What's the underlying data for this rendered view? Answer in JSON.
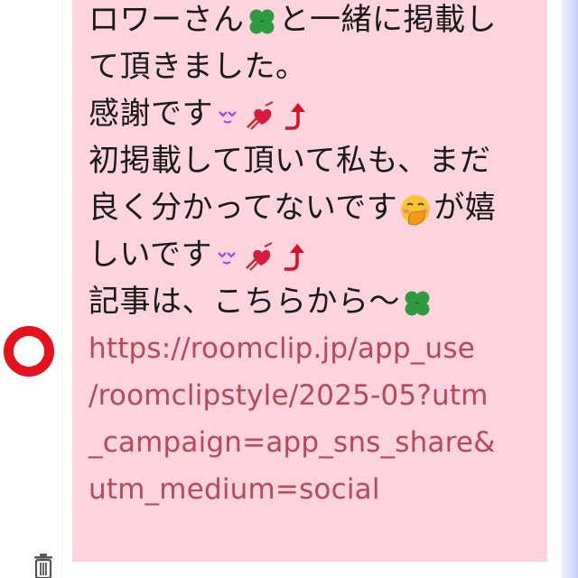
{
  "message": {
    "lines": [
      "ロワーさん",
      "と一緒に掲載し",
      "て頂きました。",
      "感謝です",
      "初掲載して頂いて私も、まだ",
      "良く分かってないです",
      "が嬉",
      "しいです",
      "記事は、こちらから〜"
    ],
    "link_lines": [
      "https://roomclip.jp/app_use",
      "/roomclipstyle/2025-05?utm",
      "_campaign=app_sns_share&",
      "utm_medium=social"
    ]
  },
  "icons": {
    "clover": "four-leaf-clover-icon",
    "sparkle_eyes": "sparkle-eyes-icon",
    "heart_arrow": "heart-with-arrow-icon",
    "up_arrow": "curved-up-arrow-icon",
    "hand_over_mouth": "face-with-hand-over-mouth-icon",
    "trash": "trash-icon",
    "ring": "red-circle-mark"
  },
  "colors": {
    "bubble": "#fdd3de",
    "text": "#1a1a1a",
    "link": "#b54a5a",
    "ring": "#e6121e",
    "clover": "#2e9b3f"
  }
}
